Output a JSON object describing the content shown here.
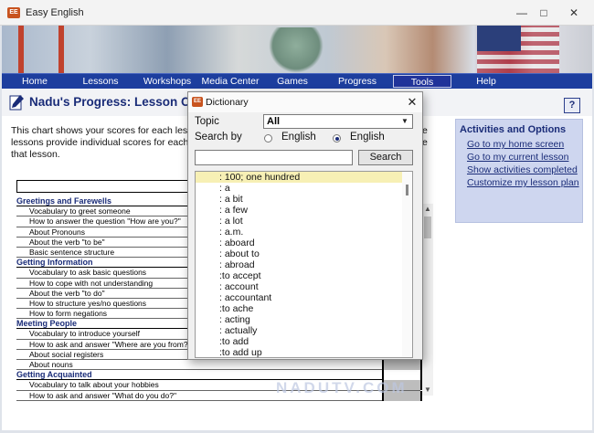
{
  "window": {
    "title": "Easy English"
  },
  "nav": [
    {
      "label": "Home",
      "active": false
    },
    {
      "label": "Lessons",
      "active": false
    },
    {
      "label": "Workshops",
      "active": false
    },
    {
      "label": "Media Center",
      "active": false
    },
    {
      "label": "Games",
      "active": false
    },
    {
      "label": "Progress",
      "active": false
    },
    {
      "label": "Tools",
      "active": true
    },
    {
      "label": "Help",
      "active": false
    }
  ],
  "page": {
    "title": "Nadu's Progress: Lesson Ob",
    "help_label": "?",
    "intro_lines": [
      "This chart shows your scores for each lesso",
      "lessons provide individual scores for each ob",
      "that lesson."
    ],
    "intro_right": "e\ne"
  },
  "chart_rows": [
    {
      "type": "section",
      "label": "Greetings and Farewells"
    },
    {
      "type": "item",
      "label": "Vocabulary to greet someone"
    },
    {
      "type": "item",
      "label": "How to answer the question \"How are you?\""
    },
    {
      "type": "item",
      "label": "About Pronouns"
    },
    {
      "type": "item",
      "label": "About the verb \"to be\""
    },
    {
      "type": "item",
      "label": "Basic sentence structure"
    },
    {
      "type": "section",
      "label": "Getting Information"
    },
    {
      "type": "item",
      "label": "Vocabulary to ask basic questions"
    },
    {
      "type": "item",
      "label": "How to cope with not understanding"
    },
    {
      "type": "item",
      "label": "About the verb \"to do\""
    },
    {
      "type": "item",
      "label": "How to structure yes/no questions"
    },
    {
      "type": "item",
      "label": "How to form negations"
    },
    {
      "type": "section",
      "label": "Meeting People"
    },
    {
      "type": "item",
      "label": "Vocabulary to introduce yourself"
    },
    {
      "type": "item",
      "label": "How to ask and answer \"Where are you from?\""
    },
    {
      "type": "item",
      "label": "About social registers"
    },
    {
      "type": "item",
      "label": "About nouns"
    },
    {
      "type": "section",
      "label": "Getting Acquainted"
    },
    {
      "type": "item",
      "label": "Vocabulary to talk about your hobbies"
    },
    {
      "type": "item",
      "label": "How to ask and answer \"What do you do?\""
    }
  ],
  "activities": {
    "title": "Activities and Options",
    "links": [
      "Go to my home screen",
      "Go to my current lesson",
      "Show activities completed",
      "Customize my lesson plan"
    ]
  },
  "dictionary": {
    "title": "Dictionary",
    "topic_label": "Topic",
    "topic_value": "All",
    "search_by_label": "Search by",
    "radio_options": [
      {
        "label": "English",
        "selected": false
      },
      {
        "label": "English",
        "selected": true
      }
    ],
    "search_value": "",
    "search_button": "Search",
    "words": [
      ": 100; one hundred",
      ": a",
      ": a bit",
      ": a few",
      ": a lot",
      ": a.m.",
      ": aboard",
      ": about to",
      ": abroad",
      ":to accept",
      ": account",
      ": accountant",
      ":to ache",
      ": acting",
      ": actually",
      ":to add",
      ":to add up"
    ],
    "selected_index": 0
  },
  "watermark": "NADUTV.COM",
  "icons": {
    "app": "app-logo-icon",
    "minimize": "minimize-icon",
    "maximize": "maximize-icon",
    "close": "close-icon",
    "pen": "pen-icon",
    "caret": "chevron-down-icon"
  },
  "colors": {
    "nav_bg": "#1d3e9e",
    "title_blue": "#1a2c78",
    "activities_bg": "#ced6ef",
    "selected_word": "#f7f0b5"
  }
}
